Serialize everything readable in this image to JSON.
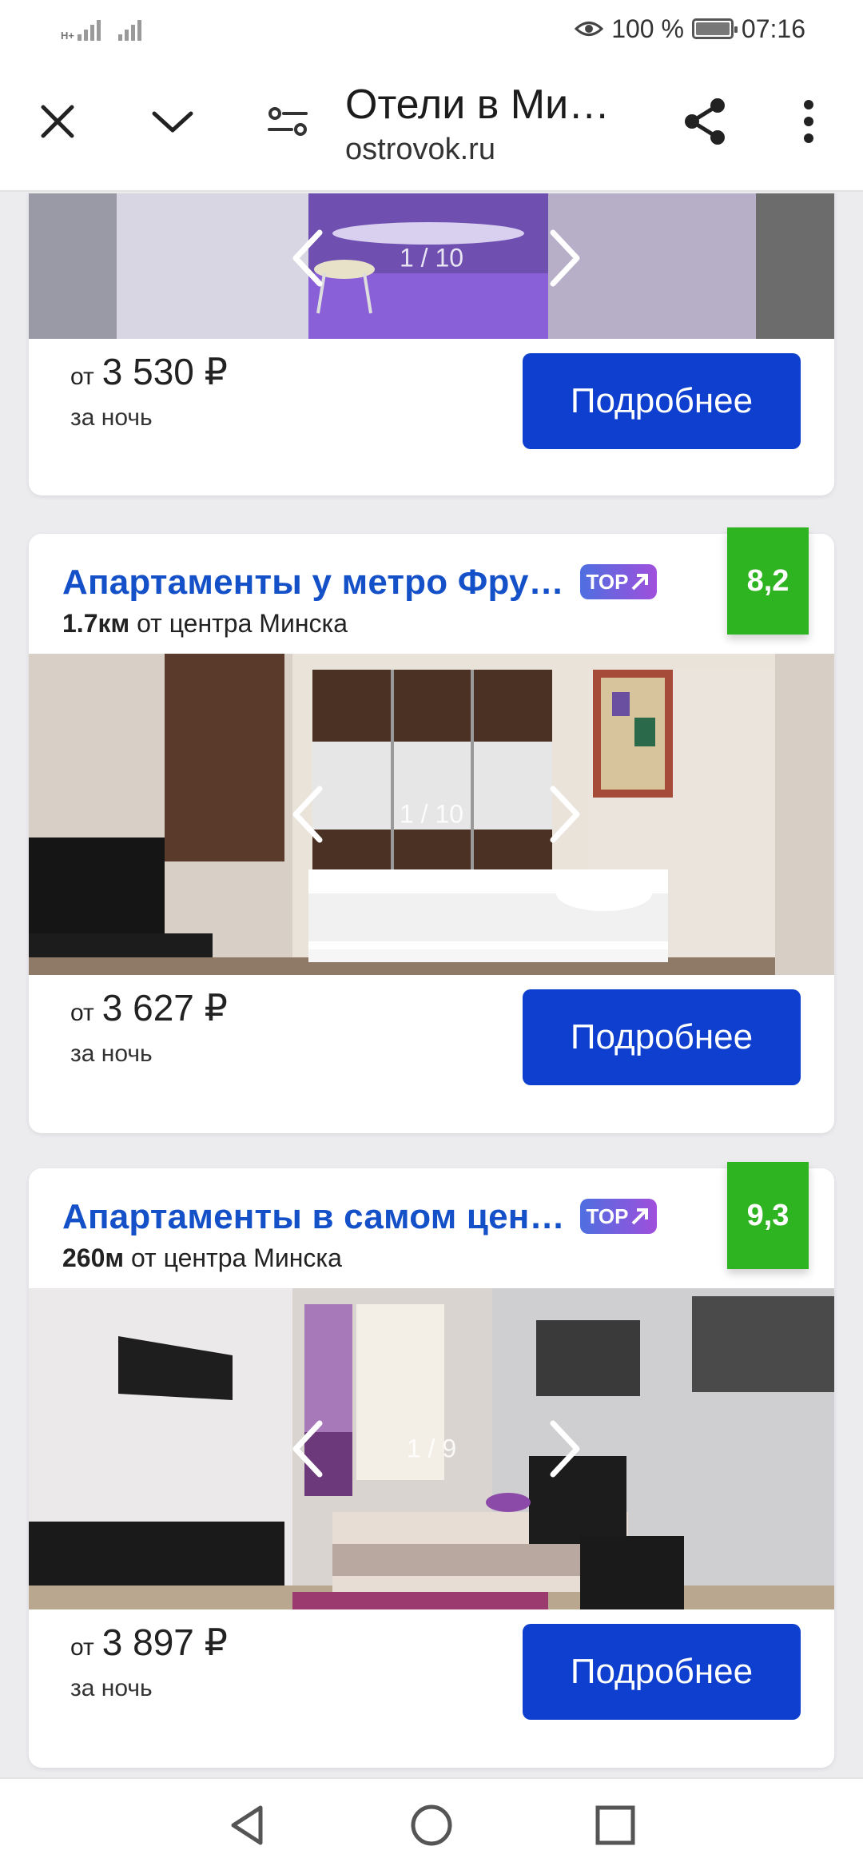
{
  "status_bar": {
    "network_type": "H+",
    "battery": "100 %",
    "time": "07:16"
  },
  "toolbar": {
    "title": "Отели в Ми…",
    "url": "ostrovok.ru"
  },
  "cards": [
    {
      "photo_counter": "1 / 10",
      "price_from": "от",
      "price": "3 530 ₽",
      "per_night": "за ночь",
      "button": "Подробнее"
    },
    {
      "name": "Апартаменты у метро Фру…",
      "badge": "TOP",
      "rating": "8,2",
      "distance_value": "1.7км",
      "distance_text": " от центра Минска",
      "photo_counter": "1 / 10",
      "price_from": "от",
      "price": "3 627 ₽",
      "per_night": "за ночь",
      "button": "Подробнее"
    },
    {
      "name": "Апартаменты в самом цен…",
      "badge": "TOP",
      "rating": "9,3",
      "distance_value": "260м",
      "distance_text": " от центра Минска",
      "photo_counter": "1 / 9",
      "price_from": "от",
      "price": "3 897 ₽",
      "per_night": "за ночь",
      "button": "Подробнее"
    }
  ],
  "colors": {
    "link_blue": "#1451c8",
    "button_blue": "#0f3fcf",
    "rating_green": "#2fb421"
  }
}
